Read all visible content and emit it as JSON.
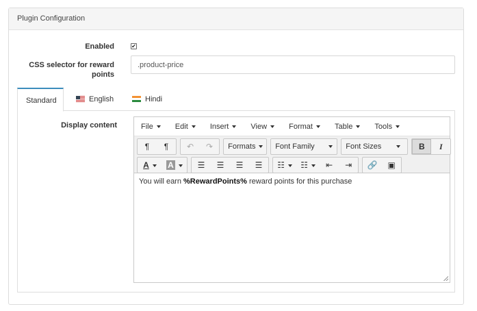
{
  "panel": {
    "title": "Plugin Configuration"
  },
  "fields": {
    "enabled_label": "Enabled",
    "enabled_checked": true,
    "css_label_line1": "CSS selector for reward",
    "css_label_line2": "points",
    "css_value": ".product-price"
  },
  "tabs": [
    {
      "label": "Standard",
      "active": true
    },
    {
      "label": "English",
      "flag": "us-flag"
    },
    {
      "label": "Hindi",
      "flag": "in-flag"
    }
  ],
  "display_content_label": "Display content",
  "editor": {
    "menus": [
      "File",
      "Edit",
      "Insert",
      "View",
      "Format",
      "Table",
      "Tools"
    ],
    "dropdowns": {
      "formats": "Formats",
      "font_family": "Font Family",
      "font_sizes": "Font Sizes"
    },
    "content_pre": "You will earn ",
    "content_bold": "%RewardPoints%",
    "content_post": " reward points for this purchase"
  },
  "colors": {
    "accent": "#3c8dbc",
    "border": "#dedede",
    "header_bg": "#f5f5f5"
  }
}
